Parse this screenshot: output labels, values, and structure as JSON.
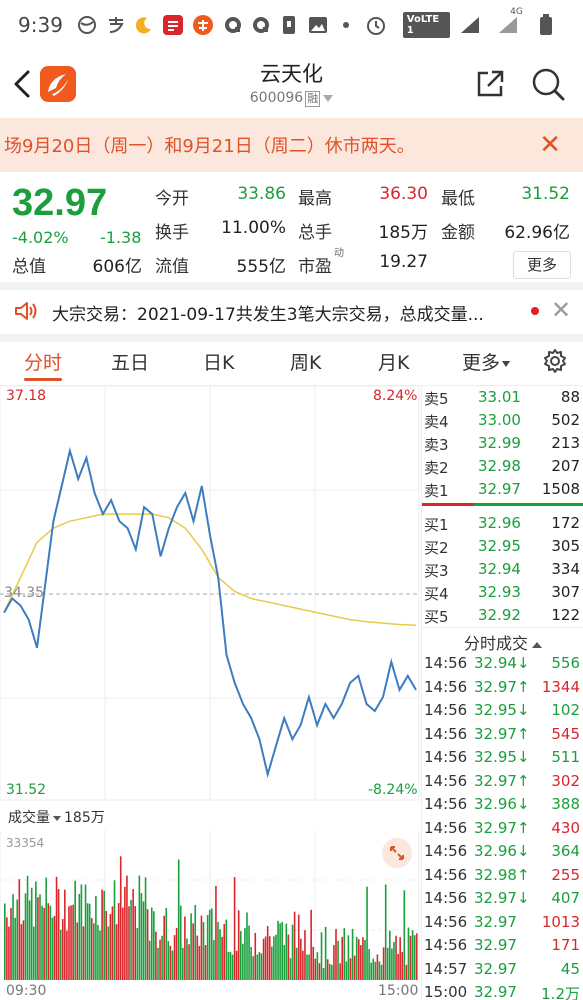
{
  "status_bar": {
    "time": "9:39",
    "network": "VoLTE 1",
    "signal2": "4G",
    "icons": [
      "globe-icon",
      "alipay-icon",
      "moon-icon",
      "app-icon",
      "taobao-icon",
      "q-icon",
      "q-icon",
      "sim-icon",
      "image-icon",
      "dot-icon",
      "alarm-icon",
      "volte-icon",
      "signal-icon",
      "signal-4g-icon",
      "battery-icon"
    ]
  },
  "header": {
    "title": "云天化",
    "code": "600096",
    "margin_badge": "融"
  },
  "notice": {
    "text": "场9月20日（周一）和9月21日（周二）休市两天。",
    "close": "✕"
  },
  "quote": {
    "price": "32.97",
    "change_pct": "-4.02%",
    "change_abs": "-1.38",
    "fields": {
      "open_label": "今开",
      "open": "33.86",
      "high_label": "最高",
      "high": "36.30",
      "low_label": "最低",
      "low": "31.52",
      "turnover_label": "换手",
      "turnover": "11.00%",
      "volume_label": "总手",
      "volume": "185万",
      "amount_label": "金额",
      "amount": "62.96亿",
      "mcap_label": "总值",
      "mcap": "606亿",
      "float_label": "流值",
      "float": "555亿",
      "pe_label": "市盈",
      "pe_sup": "动",
      "pe": "19.27"
    },
    "more_button": "更多"
  },
  "block_trade": {
    "text": "大宗交易：2021-09-17共发生3笔大宗交易，总成交量...",
    "close": "✕"
  },
  "tabs": [
    {
      "label": "分时",
      "active": true
    },
    {
      "label": "五日",
      "active": false
    },
    {
      "label": "日K",
      "active": false
    },
    {
      "label": "周K",
      "active": false
    },
    {
      "label": "月K",
      "active": false
    },
    {
      "label": "更多",
      "active": false
    }
  ],
  "chart": {
    "y_max": "37.18",
    "y_min": "31.52",
    "y_mid": "34.35",
    "pct_max": "8.24%",
    "pct_min": "-8.24%",
    "vol_label": "成交量",
    "vol_total": "185万",
    "vol_max": "33354",
    "time_start": "09:30",
    "time_end": "15:00"
  },
  "chart_data": {
    "type": "line",
    "title": "",
    "ylim": [
      31.52,
      37.18
    ],
    "x_range": [
      "09:30",
      "15:00"
    ],
    "series": [
      {
        "values": [
          34.1,
          34.3,
          34.2,
          34.0,
          33.6,
          34.5,
          35.4,
          35.9,
          36.4,
          36.0,
          36.3,
          35.8,
          35.5,
          35.7,
          35.4,
          35.3,
          35.0,
          35.6,
          35.5,
          34.9,
          35.3,
          35.6,
          35.8,
          35.4,
          35.9,
          35.2,
          34.6,
          33.5,
          33.1,
          32.8,
          32.6,
          32.3,
          31.8,
          32.2,
          32.6,
          32.3,
          32.5,
          32.9,
          32.5,
          32.8,
          32.6,
          32.8,
          33.1,
          33.2,
          32.8,
          32.7,
          32.9,
          33.4,
          33.0,
          33.2,
          33.0
        ]
      },
      {
        "values": [
          34.1,
          34.6,
          35.1,
          35.3,
          35.4,
          35.45,
          35.5,
          35.5,
          35.5,
          35.5,
          35.45,
          35.3,
          35.0,
          34.6,
          34.4,
          34.3,
          34.25,
          34.2,
          34.15,
          34.1,
          34.05,
          34.0,
          33.97,
          33.95,
          33.93,
          33.92
        ]
      }
    ],
    "volume": {
      "max": 33354
    }
  },
  "order_book": {
    "asks": [
      {
        "label": "卖5",
        "price": "33.01",
        "vol": "88"
      },
      {
        "label": "卖4",
        "price": "33.00",
        "vol": "502"
      },
      {
        "label": "卖3",
        "price": "32.99",
        "vol": "213"
      },
      {
        "label": "卖2",
        "price": "32.98",
        "vol": "207"
      },
      {
        "label": "卖1",
        "price": "32.97",
        "vol": "1508"
      }
    ],
    "bids": [
      {
        "label": "买1",
        "price": "32.96",
        "vol": "172"
      },
      {
        "label": "买2",
        "price": "32.95",
        "vol": "305"
      },
      {
        "label": "买3",
        "price": "32.94",
        "vol": "334"
      },
      {
        "label": "买4",
        "price": "32.93",
        "vol": "307"
      },
      {
        "label": "买5",
        "price": "32.92",
        "vol": "122"
      }
    ],
    "ticks_title": "分时成交",
    "ticks": [
      {
        "time": "14:56",
        "price": "32.94",
        "dir": "↓",
        "vol": "556",
        "color": "green"
      },
      {
        "time": "14:56",
        "price": "32.97",
        "dir": "↑",
        "vol": "1344",
        "color": "red"
      },
      {
        "time": "14:56",
        "price": "32.95",
        "dir": "↓",
        "vol": "102",
        "color": "green"
      },
      {
        "time": "14:56",
        "price": "32.97",
        "dir": "↑",
        "vol": "545",
        "color": "red"
      },
      {
        "time": "14:56",
        "price": "32.95",
        "dir": "↓",
        "vol": "511",
        "color": "green"
      },
      {
        "time": "14:56",
        "price": "32.97",
        "dir": "↑",
        "vol": "302",
        "color": "red"
      },
      {
        "time": "14:56",
        "price": "32.96",
        "dir": "↓",
        "vol": "388",
        "color": "green"
      },
      {
        "time": "14:56",
        "price": "32.97",
        "dir": "↑",
        "vol": "430",
        "color": "red"
      },
      {
        "time": "14:56",
        "price": "32.96",
        "dir": "↓",
        "vol": "364",
        "color": "green"
      },
      {
        "time": "14:56",
        "price": "32.98",
        "dir": "↑",
        "vol": "255",
        "color": "red"
      },
      {
        "time": "14:56",
        "price": "32.97",
        "dir": "↓",
        "vol": "407",
        "color": "green"
      },
      {
        "time": "14:56",
        "price": "32.97",
        "dir": "",
        "vol": "1013",
        "color": "red"
      },
      {
        "time": "14:56",
        "price": "32.97",
        "dir": "",
        "vol": "171",
        "color": "red"
      },
      {
        "time": "14:57",
        "price": "32.97",
        "dir": "",
        "vol": "45",
        "color": "green"
      },
      {
        "time": "15:00",
        "price": "32.97",
        "dir": "",
        "vol": "1.2万",
        "color": "green"
      }
    ]
  },
  "colors": {
    "accent": "#e0512a",
    "up": "#d9262c",
    "down": "#1a9f3c",
    "price_line": "#3d7dbf",
    "avg_line": "#e8c94b",
    "notice_bg": "#fbe7dc"
  }
}
